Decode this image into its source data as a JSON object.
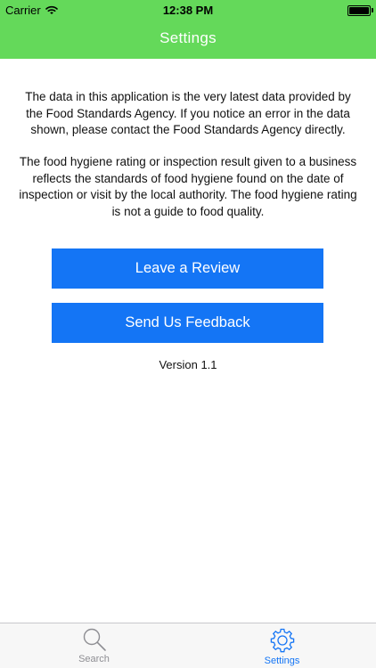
{
  "status_bar": {
    "carrier": "Carrier",
    "time": "12:38 PM"
  },
  "nav": {
    "title": "Settings"
  },
  "main": {
    "paragraph_1": "The data in this application is the very latest data provided by the Food Standards Agency. If you notice an error in the data shown, please contact the Food Standards Agency directly.",
    "paragraph_2": "The food hygiene rating or inspection result given to a business reflects the standards of food hygiene found on the date of inspection or visit by the local authority. The food hygiene rating is not a guide to food quality.",
    "review_button": "Leave a Review",
    "feedback_button": "Send Us Feedback",
    "version": "Version 1.1"
  },
  "tabbar": {
    "tabs": [
      {
        "label": "Search",
        "icon": "search-icon",
        "active": false
      },
      {
        "label": "Settings",
        "icon": "gear-icon",
        "active": true
      }
    ]
  },
  "colors": {
    "header": "#64d95a",
    "button": "#1475f5",
    "tab_active": "#1475f5",
    "tab_inactive": "#8e8e93"
  }
}
